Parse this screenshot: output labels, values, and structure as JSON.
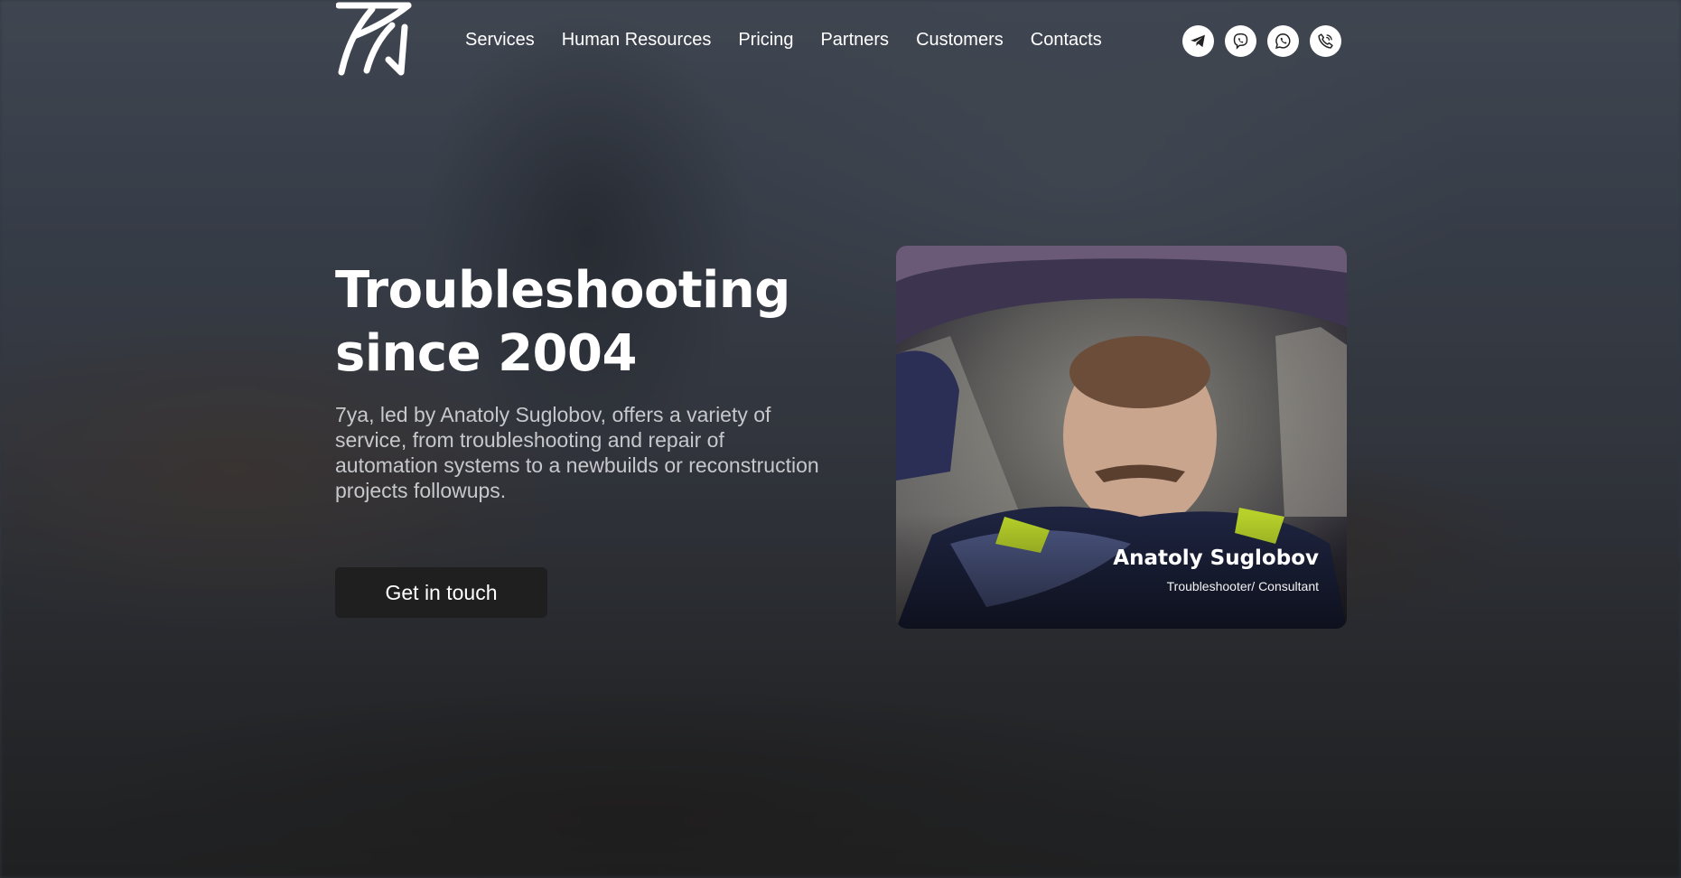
{
  "nav": {
    "items": [
      {
        "label": "Services"
      },
      {
        "label": "Human Resources"
      },
      {
        "label": "Pricing"
      },
      {
        "label": "Partners"
      },
      {
        "label": "Customers"
      },
      {
        "label": "Contacts"
      }
    ]
  },
  "socials": [
    {
      "icon": "telegram-icon"
    },
    {
      "icon": "viber-icon"
    },
    {
      "icon": "whatsapp-icon"
    },
    {
      "icon": "phone-icon"
    }
  ],
  "hero": {
    "title_line1": "Troubleshooting",
    "title_line2": "since 2004",
    "description": "7ya, led by Anatoly Suglobov, offers a variety of service, from troubleshooting and repair of automation systems to a newbuilds or reconstruction projects followups.",
    "cta_label": "Get in touch"
  },
  "profile": {
    "name": "Anatoly Suglobov",
    "role": "Troubleshooter/ Consultant"
  },
  "colors": {
    "text": "#ffffff",
    "muted_text": "#c6c8cc",
    "button_bg": "#1f1f1f",
    "icon_circle": "#ffffff"
  }
}
